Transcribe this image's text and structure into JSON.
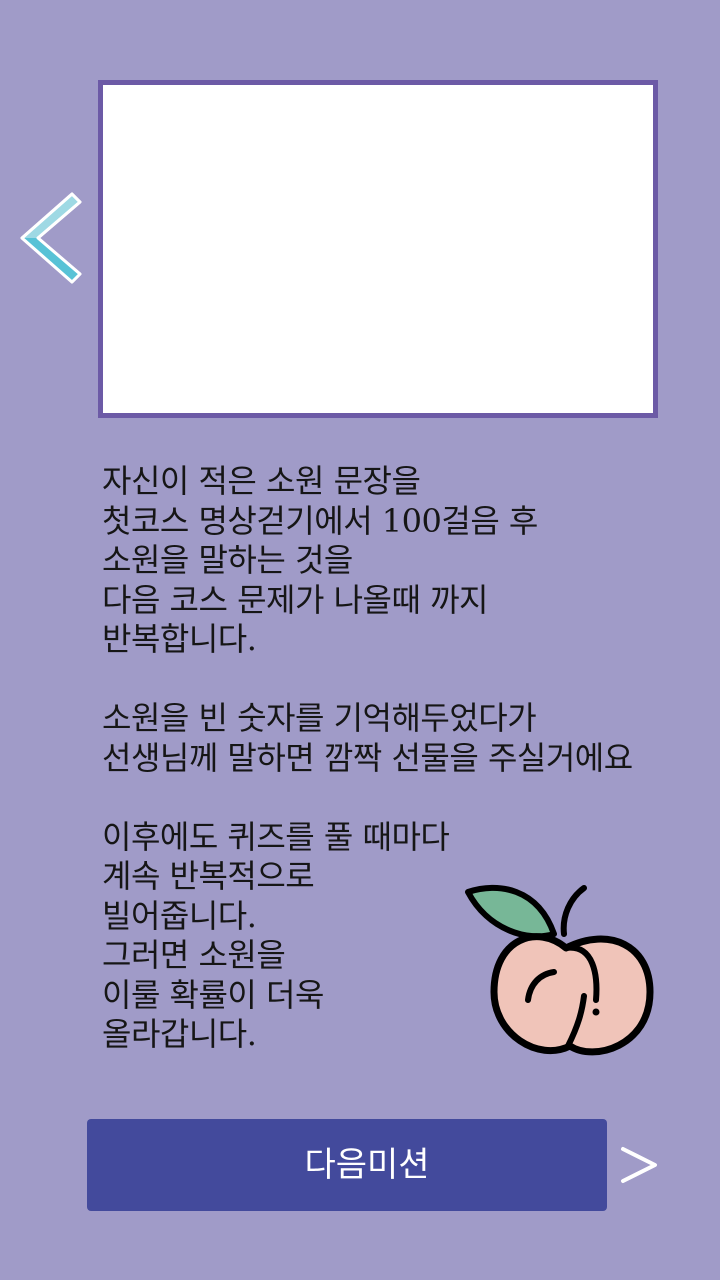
{
  "instructions": {
    "para1": [
      "자신이 적은 소원 문장을",
      "첫코스 명상걷기에서 100걸음 후",
      "소원을 말하는 것을",
      "다음 코스 문제가 나올때 까지",
      "반복합니다."
    ],
    "para2": [
      "소원을 빈 숫자를 기억해두었다가",
      "선생님께 말하면 깜짝 선물을 주실거에요"
    ],
    "para3": [
      "이후에도 퀴즈를 풀 때마다",
      "계속 반복적으로",
      "빌어줍니다.",
      "그러면 소원을",
      "이룰 확률이 더욱",
      "올라갑니다."
    ]
  },
  "next_button": {
    "label": "다음미션"
  },
  "icons": {
    "back": "chevron-left-icon",
    "next": "chevron-right-icon",
    "illustration": "peach-icon"
  },
  "colors": {
    "background": "#a09bc8",
    "frame_border": "#6c5aa6",
    "button": "#434a9c",
    "arrow": "#58c2d6",
    "peach": "#f0c4b9",
    "leaf": "#77b797"
  }
}
